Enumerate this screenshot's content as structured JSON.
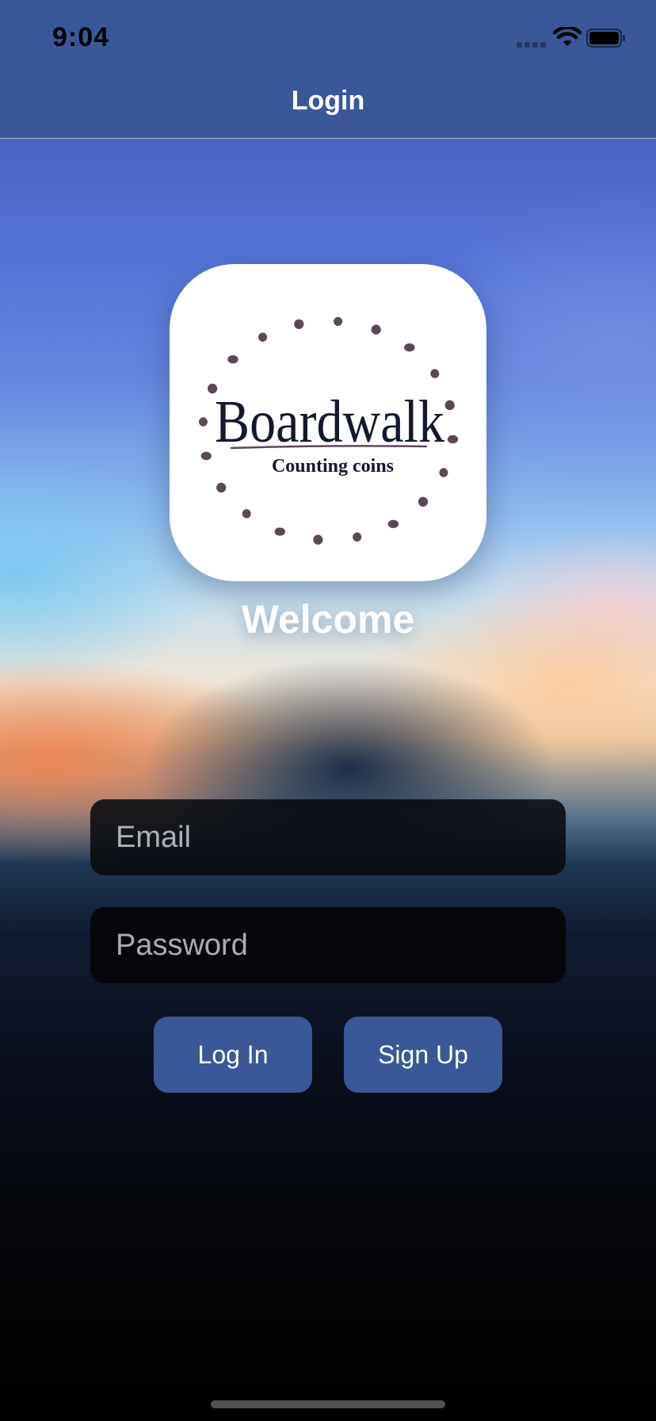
{
  "status_bar": {
    "time": "9:04",
    "icons": [
      "cellular-signal-icon",
      "wifi-icon",
      "battery-icon"
    ]
  },
  "nav": {
    "title": "Login"
  },
  "logo": {
    "brand": "Boardwalk",
    "tagline": "Counting coins",
    "dot_color": "#5a4858",
    "text_color": "#14182e"
  },
  "welcome_text": "Welcome",
  "form": {
    "email_placeholder": "Email",
    "password_placeholder": "Password"
  },
  "buttons": {
    "login_label": "Log In",
    "signup_label": "Sign Up"
  },
  "colors": {
    "bar": "#3a5898",
    "button": "#3a5898",
    "field_background": "#08090e"
  }
}
